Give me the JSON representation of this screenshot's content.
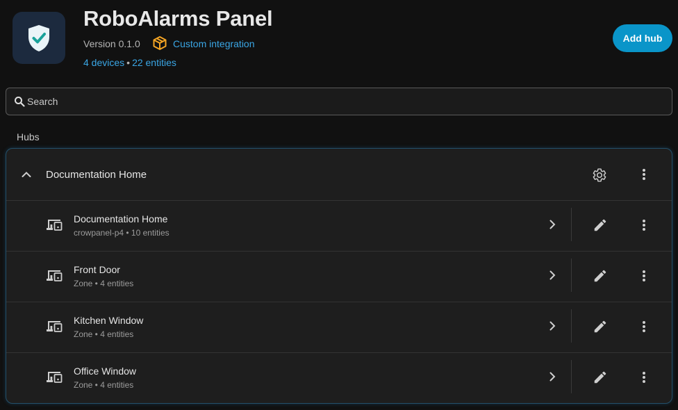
{
  "header": {
    "title": "RoboAlarms Panel",
    "version": "Version 0.1.0",
    "custom_integration": "Custom integration",
    "devices_link": "4 devices",
    "separator": "•",
    "entities_link": "22 entities",
    "add_hub_label": "Add hub",
    "app_icon": "shield-check-icon",
    "custom_icon": "package-icon"
  },
  "search": {
    "placeholder": "Search",
    "value": ""
  },
  "hubs_section": {
    "label": "Hubs",
    "hub": {
      "title": "Documentation Home",
      "devices": [
        {
          "name": "Documentation Home",
          "subtitle": "crowpanel-p4 • 10 entities"
        },
        {
          "name": "Front Door",
          "subtitle": "Zone • 4 entities"
        },
        {
          "name": "Kitchen Window",
          "subtitle": "Zone • 4 entities"
        },
        {
          "name": "Office Window",
          "subtitle": "Zone • 4 entities"
        }
      ]
    }
  },
  "colors": {
    "accent": "#0a95c9",
    "link": "#3aa6e5",
    "shield": "#eaf4f8",
    "check": "#1aa29a",
    "package": "#f5a524",
    "background": "#111111",
    "card": "#1e1e1e"
  }
}
